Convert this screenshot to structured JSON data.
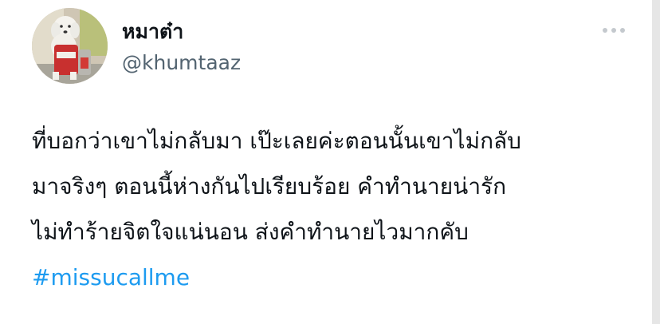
{
  "author": {
    "display_name": "หมาต๋า",
    "handle": "@khumtaaz"
  },
  "tweet": {
    "lines": [
      "ที่บอกว่าเขาไม่กลับมา เป๊ะเลยค่ะตอนนั้นเขาไม่กลับ",
      "มาจริงๆ ตอนนี้ห่างกันไปเรียบร้อย คำทำนายน่ารัก",
      "ไม่ทำร้ายจิตใจแน่นอน ส่งคำทำนายไวมากคับ"
    ],
    "hashtag": "#missucallme"
  },
  "icons": {
    "more": "more-horizontal-icon",
    "avatar": "dog-photo"
  },
  "colors": {
    "text": "#0f1419",
    "secondary": "#536471",
    "link": "#1d9bf0",
    "dots": "#c4c9ce"
  }
}
